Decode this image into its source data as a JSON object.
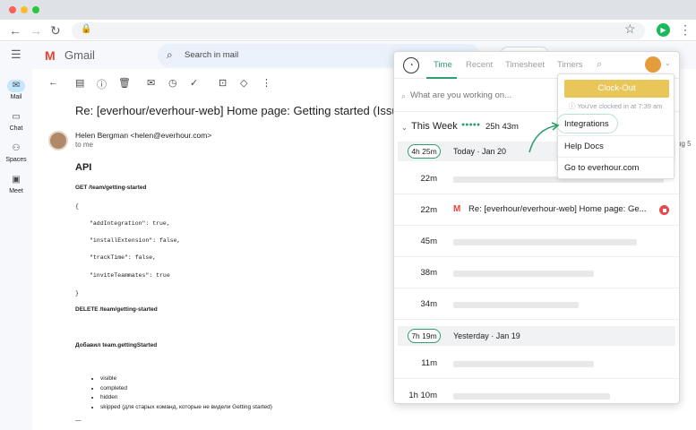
{
  "browser": {
    "title": "Gmail"
  },
  "gmail": {
    "logo_text": "Gmail",
    "search_placeholder": "Search in mail",
    "rail": [
      {
        "label": "Mail"
      },
      {
        "label": "Chat"
      },
      {
        "label": "Spaces"
      },
      {
        "label": "Meet"
      }
    ]
  },
  "email": {
    "subject": "Re: [everhour/everhour-web] Home page: Getting started (Issue #6",
    "sender": "Helen Bergman <helen@everhour.com>",
    "to": "to me",
    "heading": "API",
    "lines": {
      "get": "GET /team/getting-started",
      "brace_open": "{",
      "l1": "\"addIntegration\": true,",
      "l2": "\"installExtension\": false,",
      "l3": "\"trackTime\": false,",
      "l4": "\"inviteTeammates\": true",
      "brace_close": "}",
      "delete": "DELETE /team/getting-started",
      "added": "Добавил team.gettingStarted",
      "dash": "—"
    },
    "list": [
      "visible",
      "completed",
      "hidden",
      "skipped (для старых команд, которые не видели Getting started)"
    ]
  },
  "right_fragment": "ug 5",
  "everhour": {
    "tabs": [
      "Time",
      "Recent",
      "Timesheet",
      "Timers"
    ],
    "input_placeholder": "What are you working on...",
    "week_label": "This Week",
    "week_total": "25h 43m",
    "days": [
      {
        "pill": "4h 25m",
        "label": "Today",
        "date": "Jan 20",
        "entries": [
          {
            "dur": "22m",
            "text": ""
          },
          {
            "dur": "22m",
            "text": "Re: [everhour/everhour-web] Home page: Ge...",
            "running": true
          },
          {
            "dur": "45m",
            "text": ""
          },
          {
            "dur": "38m",
            "text": ""
          },
          {
            "dur": "34m",
            "text": ""
          }
        ]
      },
      {
        "pill": "7h 19m",
        "label": "Yesterday",
        "date": "Jan 19",
        "entries": [
          {
            "dur": "11m",
            "text": ""
          },
          {
            "dur": "1h 10m",
            "text": ""
          }
        ]
      }
    ],
    "dropdown": {
      "clock_out": "Clock-Out",
      "note": "You've clocked in at 7:39 am",
      "items": [
        "Integrations",
        "Help Docs",
        "Go to everhour.com"
      ]
    }
  },
  "colors": {
    "accent_green": "#2f9e6e",
    "clockout_yellow": "#e8c65a",
    "stop_red": "#e44b4b"
  }
}
